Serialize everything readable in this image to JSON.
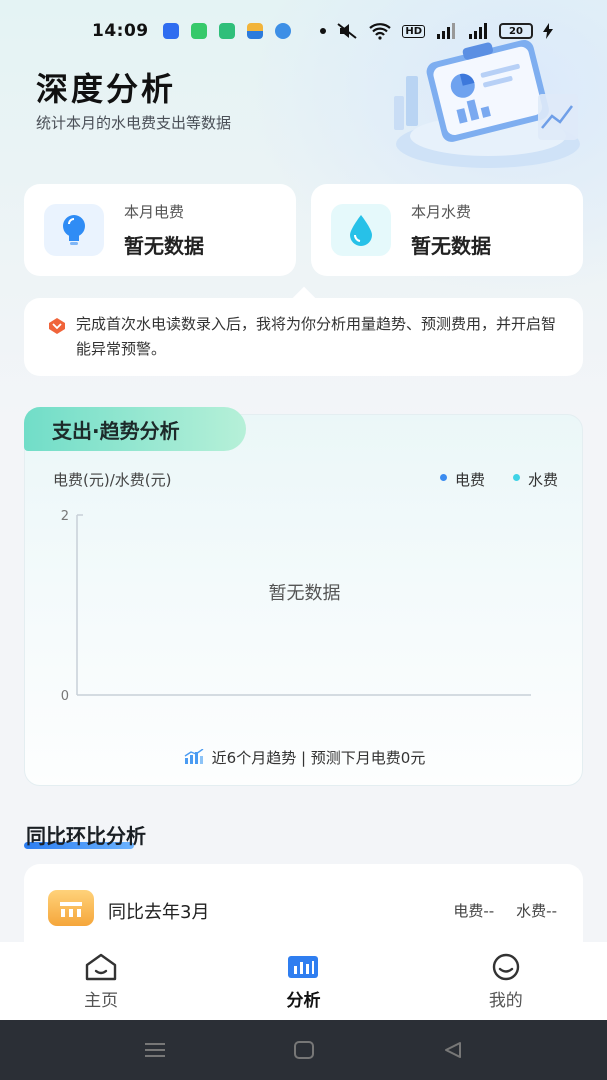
{
  "status_bar": {
    "time": "14:09",
    "battery": "20"
  },
  "header": {
    "title": "深度分析",
    "subtitle": "统计本月的水电费支出等数据"
  },
  "fee_cards": [
    {
      "label": "本月电费",
      "value": "暂无数据",
      "icon": "lightbulb-icon",
      "color": "#2f8cf5"
    },
    {
      "label": "本月水费",
      "value": "暂无数据",
      "icon": "water-drop-icon",
      "color": "#27c1e8"
    }
  ],
  "tip": {
    "text": "完成首次水电读数录入后，我将为你分析用量趋势、预测费用，并开启智能异常预警。",
    "icon": "gem-icon"
  },
  "chart_section": {
    "tag": "支出·趋势分析",
    "axis_title": "电费(元)/水费(元)",
    "empty_text": "暂无数据",
    "footer": "近6个月趋势 | 预测下月电费0元"
  },
  "chart_data": {
    "type": "line",
    "title": "",
    "ylabel": "电费(元)/水费(元)",
    "ylim": [
      0,
      2
    ],
    "yticks": [
      "2",
      "0"
    ],
    "legend": "top-right",
    "series": [
      {
        "name": "电费",
        "values": [],
        "color": "#3b8cf0"
      },
      {
        "name": "水费",
        "values": [],
        "color": "#3fd3e6"
      }
    ]
  },
  "comparison": {
    "title": "同比环比分析",
    "row_label": "同比去年3月",
    "electric": "电费--",
    "water": "水费--"
  },
  "tabs": [
    {
      "label": "主页",
      "icon": "home-icon",
      "active": false
    },
    {
      "label": "分析",
      "icon": "bar-chart-icon",
      "active": true
    },
    {
      "label": "我的",
      "icon": "smile-face-icon",
      "active": false
    }
  ],
  "system_nav": {
    "icons": [
      "menu-icon",
      "home-square-icon",
      "back-triangle-icon"
    ]
  }
}
